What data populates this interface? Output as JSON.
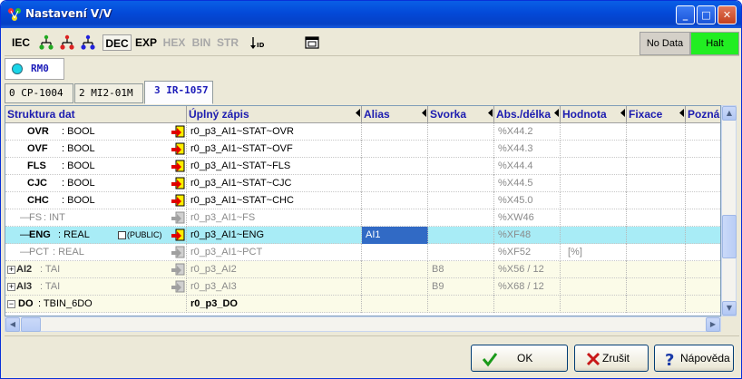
{
  "window": {
    "title": "Nastavení V/V"
  },
  "title_buttons": {
    "minimize": "_",
    "maximize": "□",
    "close": "✕"
  },
  "toolbar": {
    "iec": "IEC",
    "dec": "DEC",
    "exp": "EXP",
    "hex": "HEX",
    "bin": "BIN",
    "str": "STR",
    "status_nodata": "No Data",
    "status_halt": "Halt"
  },
  "station": {
    "label": "RM0"
  },
  "module_tabs": [
    {
      "label": "0 CP-1004"
    },
    {
      "label": "2 MI2-01M"
    },
    {
      "label": "3 IR-1057"
    }
  ],
  "columns": [
    "Struktura dat",
    "Úplný zápis",
    "Alias",
    "Svorka",
    "Abs./délka",
    "Hodnota",
    "Fixace",
    "Pozná"
  ],
  "rows": [
    {
      "name": "OVR",
      "type": ": BOOL",
      "full": "r0_p3_AI1~STAT~OVR",
      "alias": "",
      "svorka": "",
      "abs": "%X44.2",
      "hodnota": ""
    },
    {
      "name": "OVF",
      "type": ": BOOL",
      "full": "r0_p3_AI1~STAT~OVF",
      "alias": "",
      "svorka": "",
      "abs": "%X44.3",
      "hodnota": ""
    },
    {
      "name": "FLS",
      "type": ": BOOL",
      "full": "r0_p3_AI1~STAT~FLS",
      "alias": "",
      "svorka": "",
      "abs": "%X44.4",
      "hodnota": ""
    },
    {
      "name": "CJC",
      "type": ": BOOL",
      "full": "r0_p3_AI1~STAT~CJC",
      "alias": "",
      "svorka": "",
      "abs": "%X44.5",
      "hodnota": ""
    },
    {
      "name": "CHC",
      "type": ": BOOL",
      "full": "r0_p3_AI1~STAT~CHC",
      "alias": "",
      "svorka": "",
      "abs": "%X45.0",
      "hodnota": ""
    },
    {
      "name": "FS",
      "type": ": INT",
      "full": "r0_p3_AI1~FS",
      "alias": "",
      "svorka": "",
      "abs": "%XW46",
      "hodnota": ""
    },
    {
      "name": "ENG",
      "type": ": REAL",
      "public": "(PUBLIC)",
      "full": "r0_p3_AI1~ENG",
      "alias": "AI1",
      "svorka": "",
      "abs": "%XF48",
      "hodnota": ""
    },
    {
      "name": "PCT",
      "type": ": REAL",
      "full": "r0_p3_AI1~PCT",
      "alias": "",
      "svorka": "",
      "abs": "%XF52",
      "hodnota": "[%]"
    },
    {
      "name": "AI2",
      "type": ": TAI",
      "full": "r0_p3_AI2",
      "alias": "",
      "svorka": "B8",
      "abs": "%X56 / 12",
      "hodnota": ""
    },
    {
      "name": "AI3",
      "type": ": TAI",
      "full": "r0_p3_AI3",
      "alias": "",
      "svorka": "B9",
      "abs": "%X68 / 12",
      "hodnota": ""
    },
    {
      "name": "DO",
      "type": ": TBIN_6DO",
      "full": "r0_p3_DO",
      "alias": "",
      "svorka": "",
      "abs": "",
      "hodnota": ""
    }
  ],
  "buttons": {
    "ok": "OK",
    "cancel": "Zrušit",
    "help": "Nápověda"
  },
  "colors": {
    "selected_row": "#a8ecf6",
    "halt": "#22ee22",
    "header_text": "#1c1cb0"
  }
}
